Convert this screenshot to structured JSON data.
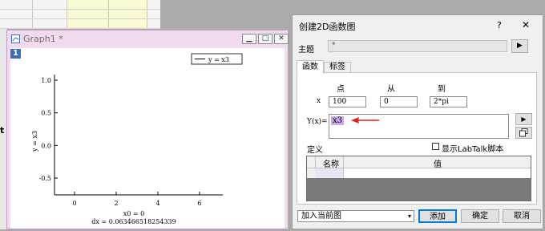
{
  "background": {
    "left_marker": "t"
  },
  "graph_window": {
    "title": "Graph1 *",
    "layer_number": "1",
    "legend_text": "y = x3",
    "y_axis_label": "y = x3",
    "y_ticks": [
      "1.0",
      "0.5",
      "0.0",
      "-0.5"
    ],
    "x_ticks": [
      "0",
      "2",
      "4",
      "6"
    ],
    "caption_line1": "x0 = 0",
    "caption_line2": "dx = 0.063466518254339"
  },
  "dialog": {
    "title": "创建2D函数图",
    "help": "?",
    "close": "✕",
    "subject_label": "主题",
    "subject_value": "*",
    "tabs": [
      "函数",
      "标签"
    ],
    "col_points": "点",
    "col_from": "从",
    "col_to": "到",
    "x_label": "x",
    "x_points": "100",
    "x_from": "0",
    "x_to": "2*pi",
    "y_label": "Y(x)=",
    "y_expression": "x3",
    "definition_label": "定义",
    "labtalk_label": "显示LabTalk脚本",
    "table_headers": [
      "名称",
      "值"
    ],
    "mode_select": "加入当前图",
    "add_button": "添加",
    "ok_button": "确定",
    "cancel_button": "取消"
  },
  "chart_data": {
    "type": "line",
    "series": [
      {
        "name": "y = x3",
        "x": [],
        "y": []
      }
    ],
    "xlabel": "",
    "ylabel": "y = x3",
    "x_ticks": [
      0,
      2,
      4,
      6
    ],
    "y_ticks": [
      1.0,
      0.5,
      0.0,
      -0.5
    ],
    "legend": "top-right",
    "grid": false
  }
}
